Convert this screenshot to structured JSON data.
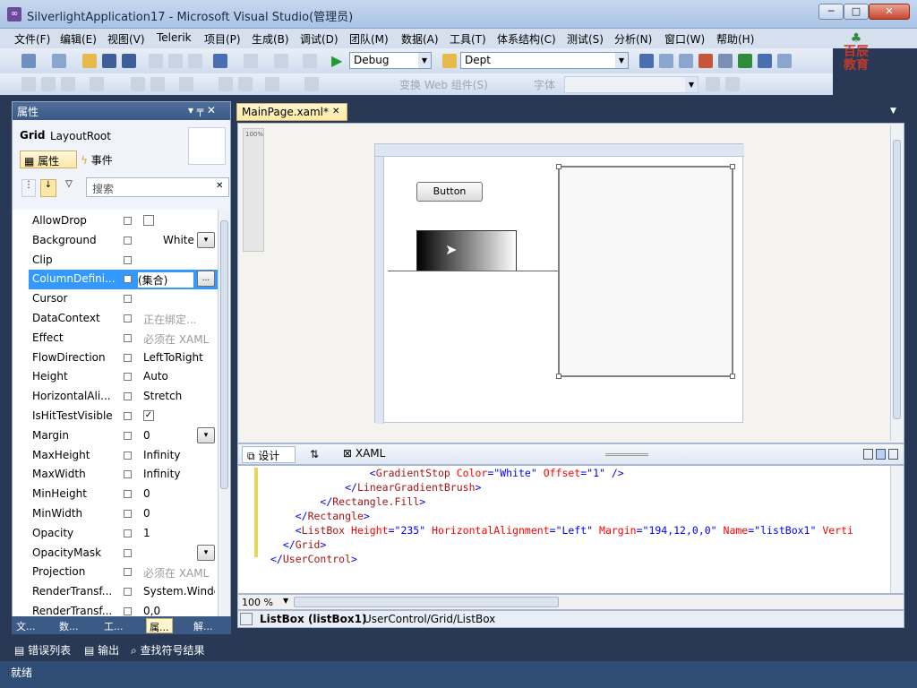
{
  "window": {
    "title": "SilverlightApplication17 - Microsoft Visual Studio(管理员)",
    "minimize": "─",
    "maximize": "□",
    "close": "✕"
  },
  "menu": [
    "文件(F)",
    "编辑(E)",
    "视图(V)",
    "Telerik",
    "项目(P)",
    "生成(B)",
    "调试(D)",
    "团队(M)",
    "数据(A)",
    "工具(T)",
    "体系结构(C)",
    "测试(S)",
    "分析(N)",
    "窗口(W)",
    "帮助(H)"
  ],
  "toolbar": {
    "config_combo": "Debug",
    "find_combo": "Dept",
    "zoom_label": "变换 Web 组件(S)",
    "combo2_label": "字体"
  },
  "logo": {
    "line1": "百辰",
    "line2": "教育"
  },
  "properties_panel": {
    "header": "属性",
    "pin": "▾ ╤ ✕",
    "type_name": "Grid",
    "element_name": "LayoutRoot",
    "tab_properties": "属性",
    "tab_events": "事件",
    "search_placeholder": "搜索",
    "search_clear": "✕",
    "rows": [
      {
        "name": "AllowDrop",
        "value": "",
        "gray": false,
        "check": "box"
      },
      {
        "name": "Background",
        "value": "White",
        "gray": false,
        "btn": "▾"
      },
      {
        "name": "Clip",
        "value": "",
        "gray": false
      },
      {
        "name": "ColumnDefini...",
        "value": "(集合)",
        "gray": false,
        "btn": "...",
        "selected": true
      },
      {
        "name": "Cursor",
        "value": "",
        "gray": false
      },
      {
        "name": "DataContext",
        "value": "正在绑定...",
        "gray": true
      },
      {
        "name": "Effect",
        "value": "必须在 XAML",
        "gray": true
      },
      {
        "name": "FlowDirection",
        "value": "LeftToRight",
        "gray": false
      },
      {
        "name": "Height",
        "value": "Auto",
        "gray": false
      },
      {
        "name": "HorizontalAli...",
        "value": "Stretch",
        "gray": false
      },
      {
        "name": "IsHitTestVisible",
        "value": "",
        "gray": false,
        "check": "checked"
      },
      {
        "name": "Margin",
        "value": "0",
        "gray": false,
        "btn": "▾"
      },
      {
        "name": "MaxHeight",
        "value": "Infinity",
        "gray": false
      },
      {
        "name": "MaxWidth",
        "value": "Infinity",
        "gray": false
      },
      {
        "name": "MinHeight",
        "value": "0",
        "gray": false
      },
      {
        "name": "MinWidth",
        "value": "0",
        "gray": false
      },
      {
        "name": "Opacity",
        "value": "1",
        "gray": false
      },
      {
        "name": "OpacityMask",
        "value": "",
        "gray": false,
        "btn": "▾"
      },
      {
        "name": "Projection",
        "value": "必须在 XAML",
        "gray": true
      },
      {
        "name": "RenderTransf...",
        "value": "System.Windo",
        "gray": false
      },
      {
        "name": "RenderTransf...",
        "value": "0,0",
        "gray": false
      }
    ],
    "bottom_tabs": [
      "文...",
      "数...",
      "工...",
      "属...",
      "解..."
    ]
  },
  "editor": {
    "tab_title": "MainPage.xaml*",
    "tab_close": "✕",
    "zoom_top": "100%",
    "canvas_button": "Button",
    "tab_design": "设计",
    "tab_swap": "⇅",
    "tab_xaml": "XAML",
    "code_lines": [
      {
        "indent": "                ",
        "parts": [
          [
            "br",
            "<"
          ],
          [
            "tag",
            "GradientStop"
          ],
          [
            "at",
            " Color"
          ],
          [
            "br",
            "="
          ],
          [
            "av",
            "\"White\""
          ],
          [
            "at",
            " Offset"
          ],
          [
            "br",
            "="
          ],
          [
            "av",
            "\"1\""
          ],
          [
            "br",
            " />"
          ]
        ]
      },
      {
        "indent": "            ",
        "parts": [
          [
            "br",
            "</"
          ],
          [
            "tag",
            "LinearGradientBrush"
          ],
          [
            "br",
            ">"
          ]
        ]
      },
      {
        "indent": "        ",
        "parts": [
          [
            "br",
            "</"
          ],
          [
            "tag",
            "Rectangle.Fill"
          ],
          [
            "br",
            ">"
          ]
        ]
      },
      {
        "indent": "    ",
        "parts": [
          [
            "br",
            "</"
          ],
          [
            "tag",
            "Rectangle"
          ],
          [
            "br",
            ">"
          ]
        ]
      },
      {
        "indent": "    ",
        "parts": [
          [
            "br",
            "<"
          ],
          [
            "tag",
            "ListBox"
          ],
          [
            "at",
            " Height"
          ],
          [
            "br",
            "="
          ],
          [
            "av",
            "\"235\""
          ],
          [
            "at",
            " HorizontalAlignment"
          ],
          [
            "br",
            "="
          ],
          [
            "av",
            "\"Left\""
          ],
          [
            "at",
            " Margin"
          ],
          [
            "br",
            "="
          ],
          [
            "av",
            "\"194,12,0,0\""
          ],
          [
            "at",
            " Name"
          ],
          [
            "br",
            "="
          ],
          [
            "av",
            "\"listBox1\""
          ],
          [
            "at",
            " Verti"
          ]
        ]
      },
      {
        "indent": "  ",
        "parts": [
          [
            "br",
            "</"
          ],
          [
            "tag",
            "Grid"
          ],
          [
            "br",
            ">"
          ]
        ]
      },
      {
        "indent": "",
        "parts": [
          [
            "br",
            "</"
          ],
          [
            "tag",
            "UserControl"
          ],
          [
            "br",
            ">"
          ]
        ]
      }
    ],
    "zoom_bottom": "100 %",
    "breadcrumb_bold": "ListBox (listBox1)",
    "breadcrumb_path": "UserControl/Grid/ListBox"
  },
  "bottom_panel_tabs": [
    "错误列表",
    "输出",
    "查找符号结果"
  ],
  "status": "就绪"
}
